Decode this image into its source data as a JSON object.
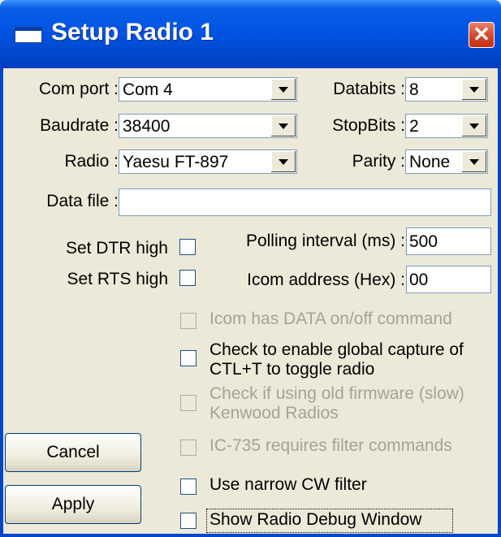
{
  "window": {
    "title": "Setup Radio 1"
  },
  "labels": {
    "com_port": "Com port :",
    "baudrate": "Baudrate :",
    "radio": "Radio :",
    "data_file": "Data file :",
    "databits": "Databits :",
    "stopbits": "StopBits :",
    "parity": "Parity :",
    "set_dtr": "Set DTR high",
    "set_rts": "Set RTS high",
    "polling": "Polling interval (ms) :",
    "icom_address": "Icom address (Hex) :"
  },
  "values": {
    "com_port": "Com 4",
    "baudrate": "38400",
    "radio": "Yaesu FT-897",
    "data_file": "",
    "databits": "8",
    "stopbits": "2",
    "parity": "None",
    "polling": "500",
    "icom_address": "00"
  },
  "checkboxes": {
    "icom_data": {
      "label": "Icom has DATA on/off command",
      "checked": false,
      "enabled": false
    },
    "global_capture": {
      "label": "Check to enable global capture of CTL+T to toggle radio",
      "checked": false,
      "enabled": true
    },
    "old_firmware": {
      "label": "Check if using old firmware (slow) Kenwood Radios",
      "checked": false,
      "enabled": false
    },
    "ic735": {
      "label": "IC-735 requires filter commands",
      "checked": false,
      "enabled": false
    },
    "narrow_cw": {
      "label": "Use narrow CW filter",
      "checked": false,
      "enabled": true
    },
    "debug_window": {
      "label": "Show Radio Debug Window",
      "checked": false,
      "enabled": true
    }
  },
  "buttons": {
    "cancel": "Cancel",
    "apply": "Apply"
  },
  "colors": {
    "titlebar": "#0054e3",
    "dialog_bg": "#ece9d8",
    "close": "#d5452a"
  },
  "icons": {
    "app": "window-icon",
    "close": "close-icon"
  }
}
